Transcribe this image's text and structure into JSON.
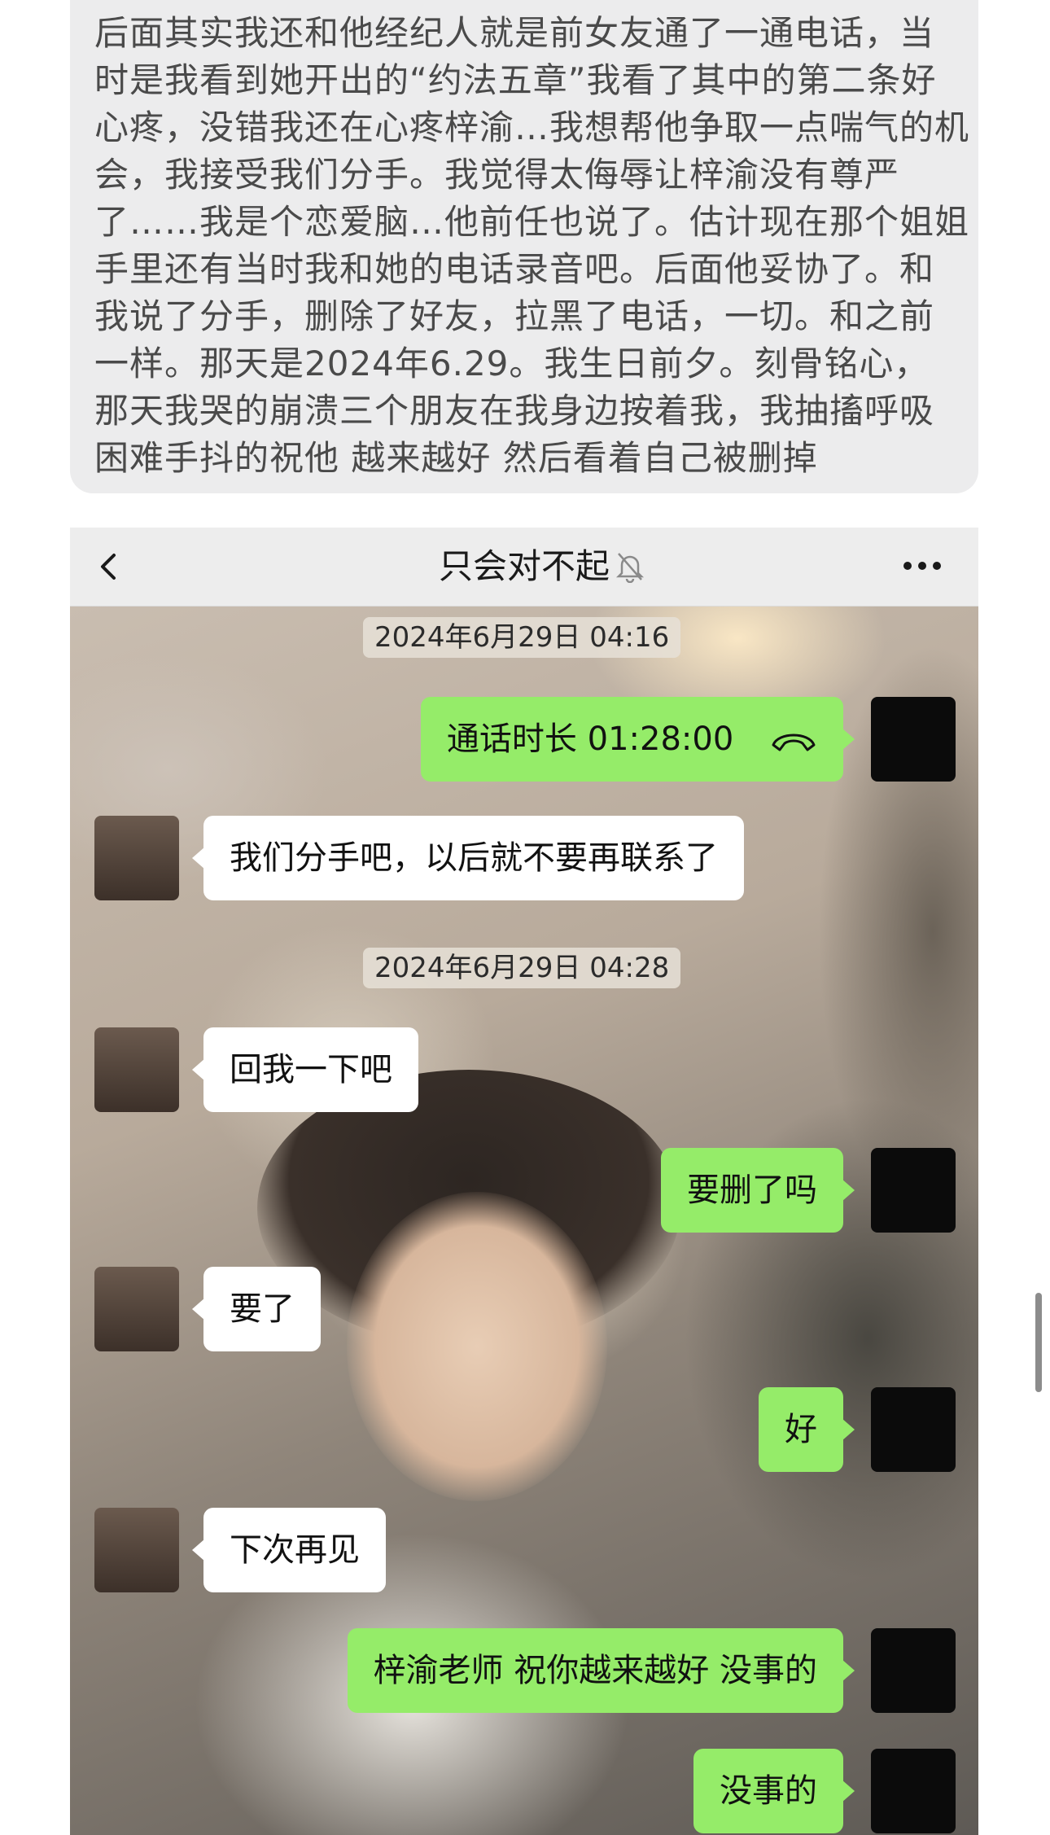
{
  "note": {
    "lines": [
      "后面其实我还和他经纪人就是前女友通了一通电话，当",
      "时是我看到她开出的“约法五章”我看了其中的第二条好",
      "心疼，没错我还在心疼梓渝…我想帮他争取一点喘气的机",
      "会，我接受我们分手。我觉得太侮辱让梓渝没有尊严",
      "了……我是个恋爱脑…他前任也说了。估计现在那个姐姐",
      "手里还有当时我和她的电话录音吧。后面他妥协了。和",
      "我说了分手，删除了好友，拉黑了电话，一切。和之前",
      "一样。那天是2024年6.29。我生日前夕。刻骨铭心，",
      "那天我哭的崩溃三个朋友在我身边按着我，我抽搐呼吸",
      "困难手抖的祝他  越来越好  然后看着自己被删掉"
    ]
  },
  "chat": {
    "title": "只会对不起",
    "icons": {
      "back": "chevron-left-icon",
      "mute": "bell-off-icon",
      "more": "more-dots-icon",
      "call": "phone-hangup-icon"
    },
    "timestamps": [
      "2024年6月29日 04:16",
      "2024年6月29日 04:28"
    ],
    "messages": [
      {
        "from": "me",
        "text": "通话时长 01:28:00"
      },
      {
        "from": "them",
        "text": "我们分手吧，以后就不要再联系了"
      },
      {
        "from": "them",
        "text": "回我一下吧"
      },
      {
        "from": "me",
        "text": "要删了吗"
      },
      {
        "from": "them",
        "text": "要了"
      },
      {
        "from": "me",
        "text": "好"
      },
      {
        "from": "them",
        "text": "下次再见"
      },
      {
        "from": "me",
        "text": "梓渝老师 祝你越来越好 没事的"
      },
      {
        "from": "me",
        "text": "没事的"
      }
    ],
    "colors": {
      "me_bubble": "#95ec69",
      "them_bubble": "#ffffff",
      "navbar": "#ededed"
    }
  }
}
